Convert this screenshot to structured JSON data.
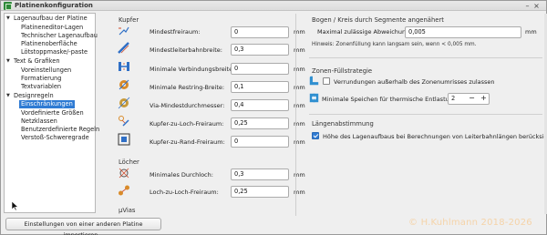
{
  "window": {
    "title": "Platinenkonfiguration"
  },
  "tree": {
    "groups": [
      {
        "label": "Lagenaufbau der Platine",
        "children": [
          "Platineneditor-Lagen",
          "Technischer Lagenaufbau",
          "Platinenoberfläche",
          "Lötstoppmaske/-paste"
        ]
      },
      {
        "label": "Text & Grafiken",
        "children": [
          "Voreinstellungen",
          "Formatierung",
          "Textvariablen"
        ]
      },
      {
        "label": "Designregeln",
        "children": [
          "Einschränkungen",
          "Vordefinierte Größen",
          "Netzklassen",
          "Benutzerdefinierte Regeln",
          "Verstoß-Schweregrade"
        ]
      }
    ],
    "selected": "Einschränkungen"
  },
  "import_button": "Einstellungen von einer anderen Platine importieren...",
  "kupfer": {
    "title": "Kupfer",
    "rows": [
      {
        "icon": "min-clearance-icon",
        "label": "Mindestfreiraum:",
        "value": "0",
        "unit": "mm"
      },
      {
        "icon": "min-track-width-icon",
        "label": "Mindestleiterbahnbreite:",
        "value": "0,3",
        "unit": "mm"
      },
      {
        "icon": "min-connection-width-icon",
        "label": "Minimale Verbindungsbreite:",
        "value": "0",
        "unit": "mm"
      },
      {
        "icon": "min-annular-ring-icon",
        "label": "Minimale Restring-Breite:",
        "value": "0,1",
        "unit": "mm"
      },
      {
        "icon": "via-min-diameter-icon",
        "label": "Via-Mindestdurchmesser:",
        "value": "0,4",
        "unit": "mm"
      },
      {
        "icon": "copper-hole-clearance-icon",
        "label": "Kupfer-zu-Loch-Freiraum:",
        "value": "0,25",
        "unit": "mm"
      },
      {
        "icon": "copper-edge-clearance-icon",
        "label": "Kupfer-zu-Rand-Freiraum:",
        "value": "0",
        "unit": "mm"
      }
    ]
  },
  "loecher": {
    "title": "Löcher",
    "rows": [
      {
        "icon": "min-hole-icon",
        "label": "Minimales Durchloch:",
        "value": "0,3",
        "unit": "mm"
      },
      {
        "icon": "hole-to-hole-icon",
        "label": "Loch-zu-Loch-Freiraum:",
        "value": "0,25",
        "unit": "mm"
      }
    ]
  },
  "uvias": {
    "title": "µVias"
  },
  "arc": {
    "title": "Bogen / Kreis durch Segmente angenähert",
    "label": "Maximal zulässige Abweichung:",
    "value": "0,005",
    "unit": "mm",
    "hint": "Hinweis: Zonenfüllung kann langsam sein, wenn < 0,005 mm."
  },
  "zone": {
    "title": "Zonen-Füllstrategie",
    "outside_label": "Verrundungen außerhalb des Zonenumrisses zulassen",
    "outside_checked": false,
    "spokes_label": "Minimale Speichen für thermische Entlastung:",
    "spokes_value": "2",
    "minus": "−",
    "plus": "+"
  },
  "length": {
    "title": "Längenabstimmung",
    "label": "Höhe des Lagenaufbaus bei Berechnungen von Leiterbahnlängen berücksichtigen",
    "checked": true
  },
  "watermark": "© H.Kuhlmann 2018-2026"
}
